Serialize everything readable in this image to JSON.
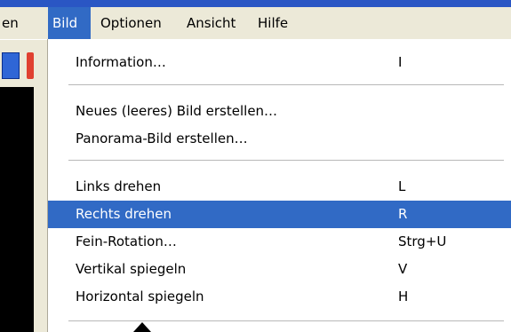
{
  "menubar": {
    "items": [
      {
        "label": "en",
        "active": false
      },
      {
        "label": "Bild",
        "active": true
      },
      {
        "label": "Optionen",
        "active": false
      },
      {
        "label": "Ansicht",
        "active": false
      },
      {
        "label": "Hilfe",
        "active": false
      }
    ]
  },
  "menu": {
    "items": [
      {
        "label": "Information…",
        "shortcut": "I"
      },
      {
        "label": "Neues (leeres) Bild erstellen…",
        "shortcut": ""
      },
      {
        "label": "Panorama-Bild erstellen…",
        "shortcut": ""
      },
      {
        "label": "Links drehen",
        "shortcut": "L"
      },
      {
        "label": "Rechts drehen",
        "shortcut": "R",
        "highlighted": true
      },
      {
        "label": "Fein-Rotation…",
        "shortcut": "Strg+U"
      },
      {
        "label": "Vertikal spiegeln",
        "shortcut": "V"
      },
      {
        "label": "Horizontal spiegeln",
        "shortcut": "H"
      }
    ]
  },
  "colors": {
    "highlight": "#316ac5",
    "menubar": "#ece9d8",
    "title_strip": "#2a56c4"
  },
  "icons": {
    "cursor": "mouse-pointer-icon",
    "toolbar": "toolbar-button-icon"
  }
}
